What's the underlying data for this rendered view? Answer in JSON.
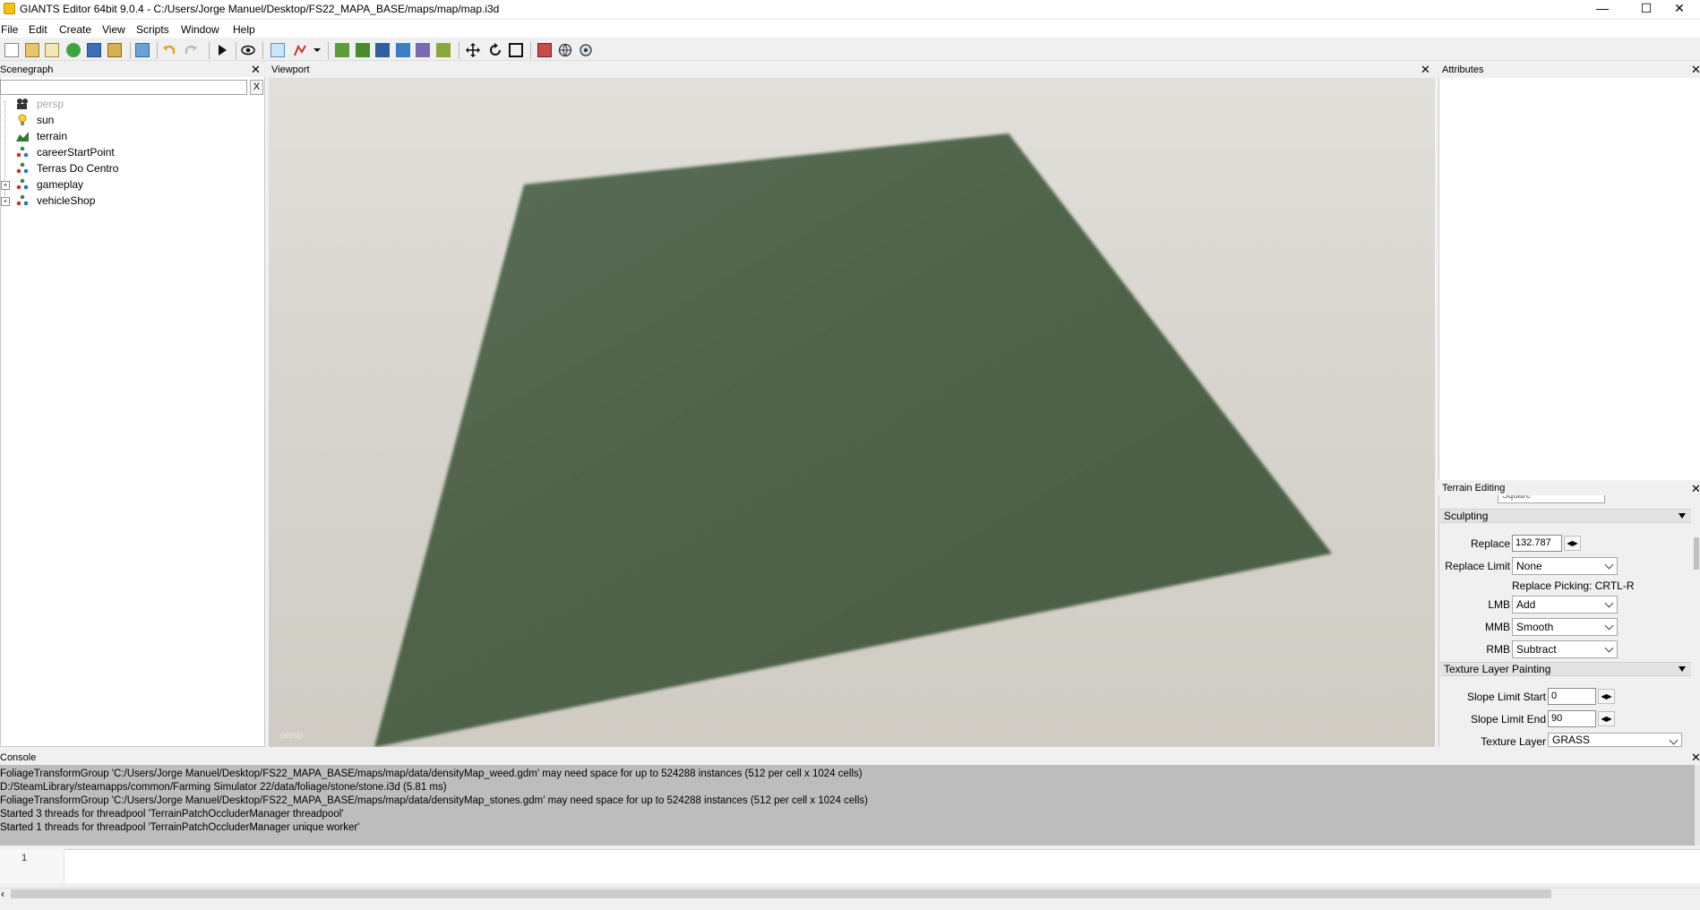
{
  "window": {
    "title": "GIANTS Editor 64bit 9.0.4 - C:/Users/Jorge Manuel/Desktop/FS22_MAPA_BASE/maps/map/map.i3d",
    "minimize": "—",
    "maximize": "☐",
    "close": "✕"
  },
  "menu": [
    "File",
    "Edit",
    "Create",
    "View",
    "Scripts",
    "Window",
    "Help"
  ],
  "panels": {
    "scenegraph": "Scenegraph",
    "viewport": "Viewport",
    "attributes": "Attributes",
    "terrain_editing": "Terrain Editing",
    "console": "Console",
    "close_symbol": "✕"
  },
  "scenegraph": {
    "filter_clear": "X",
    "items": [
      {
        "label": "persp",
        "icon": "camera-icon",
        "dimmed": true
      },
      {
        "label": "sun",
        "icon": "light-bulb-icon"
      },
      {
        "label": "terrain",
        "icon": "terrain-icon"
      },
      {
        "label": "careerStartPoint",
        "icon": "transform-group-icon"
      },
      {
        "label": "Terras Do Centro",
        "icon": "transform-group-icon"
      },
      {
        "label": "gameplay",
        "icon": "transform-group-icon",
        "expandable": true
      },
      {
        "label": "vehicleShop",
        "icon": "transform-group-icon",
        "expandable": true
      }
    ]
  },
  "viewport": {
    "camera_label": "persp",
    "terrain_color": "#4d6248"
  },
  "terrain_editing": {
    "cut_off_value": "Square",
    "sculpting": {
      "header": "Sculpting",
      "replace_label": "Replace",
      "replace_value": "132.787",
      "replace_limit_label": "Replace Limit",
      "replace_limit_value": "None",
      "replace_picking": "Replace Picking: CRTL-R",
      "lmb_label": "LMB",
      "lmb_value": "Add",
      "mmb_label": "MMB",
      "mmb_value": "Smooth",
      "rmb_label": "RMB",
      "rmb_value": "Subtract"
    },
    "texture_layer_painting": {
      "header": "Texture Layer Painting",
      "slope_start_label": "Slope Limit Start",
      "slope_start_value": "0",
      "slope_end_label": "Slope Limit End",
      "slope_end_value": "90",
      "texture_layer_label": "Texture Layer",
      "texture_layer_value": "GRASS"
    }
  },
  "console": {
    "lines": [
      "FoliageTransformGroup 'C:/Users/Jorge Manuel/Desktop/FS22_MAPA_BASE/maps/map/data/densityMap_weed.gdm' may need space for up to 524288 instances (512 per cell x 1024 cells)",
      "D:/SteamLibrary/steamapps/common/Farming Simulator 22/data/foliage/stone/stone.i3d (5.81 ms)",
      "FoliageTransformGroup 'C:/Users/Jorge Manuel/Desktop/FS22_MAPA_BASE/maps/map/data/densityMap_stones.gdm' may need space for up to 524288 instances (512 per cell x 1024 cells)",
      "Started 3 threads for threadpool 'TerrainPatchOccluderManager threadpool'",
      "Started 1 threads for threadpool 'TerrainPatchOccluderManager unique worker'"
    ],
    "input_line_number": "1"
  },
  "colors": {
    "console_bg": "#bdbdbd",
    "terrain": "#4d6248",
    "app_icon": "#f2c314"
  }
}
